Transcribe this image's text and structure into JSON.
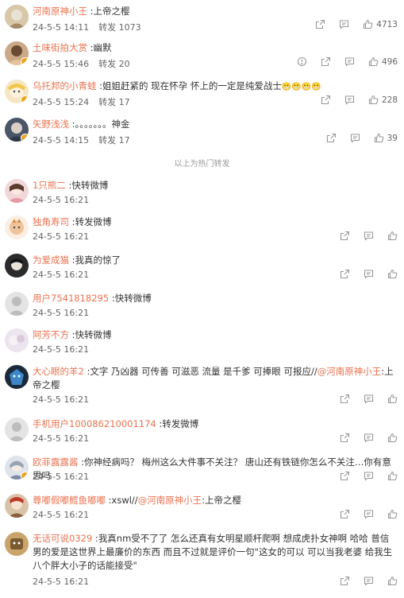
{
  "hot_reposts": [
    {
      "user": "河南原神小王",
      "text": "上帝之樱",
      "date": "24-5-5 14:11",
      "reposts": "转发 1073",
      "likes": "4713",
      "report": false
    },
    {
      "user": "土味街拍大赏",
      "text": "幽默",
      "date": "24-5-5 15:46",
      "reposts": "转发 20",
      "likes": "496",
      "report": true
    },
    {
      "user": "乌托邦的小青蛙",
      "text": "姐姐赶紧的 现在怀孕 怀上的一定是纯爱战士",
      "emoji": "😬😬😬😬",
      "date": "24-5-5 15:24",
      "reposts": "转发 17",
      "likes": "228",
      "report": false
    },
    {
      "user": "矢野浅浅",
      "text": "。。。。。。。神金",
      "date": "24-5-5 14:15",
      "reposts": "转发 17",
      "likes": "39",
      "report": false
    }
  ],
  "divider_text": "以上为热门转发",
  "reposts": [
    {
      "user": "1只熊二",
      "text": "快转微博",
      "date": "24-5-5 16:21",
      "actions": false
    },
    {
      "user": "独角寿司",
      "text": "转发微博",
      "date": "24-5-5 16:21",
      "actions": true
    },
    {
      "user": "为爱成猫",
      "text": "我真的惊了",
      "date": "24-5-5 16:21",
      "actions": true
    },
    {
      "user": "用户7541818295",
      "text": "快转微博",
      "date": "24-5-5 16:21",
      "actions": false
    },
    {
      "user": "阿芳不方",
      "text": "快转微博",
      "date": "24-5-5 16:21",
      "actions": false
    },
    {
      "user": "大心眼的羊2",
      "text": "文字 乃凶器  可传善 可滋恶 流量 是千爹 可捧眼 可报应//",
      "mention": "@河南原神小王",
      "tail": ":上帝之樱",
      "date": "24-5-5 16:21",
      "actions": true
    },
    {
      "user": "手机用户100086210001174",
      "text": "转发微博",
      "date": "24-5-5 16:21",
      "actions": true
    },
    {
      "user": "欧菲露露酱",
      "text": "你神经病吗？ 梅州这么大件事不关注？ 唐山还有铁链你怎么不关注…你有意思吗",
      "date": "24-5-5 16:21",
      "actions": true
    },
    {
      "user": "尊嘟假嘟鳕鱼嘟嘟",
      "text": "xswl//",
      "mention": "@河南原神小王",
      "tail": ":上帝之樱",
      "date": "24-5-5 16:21",
      "actions": true
    },
    {
      "user": "无话可说0329",
      "text": "我真nm受不了了 怎么还真有女明星顺杆爬啊 想成虎扑女神啊 哈哈 普信男的爱是这世界上最廉价的东西 而且不过就是评价一句\"这女的可以 可以当我老婆 给我生八个胖大小子的话能接受\"",
      "date": "24-5-5 16:21",
      "actions": true
    }
  ]
}
